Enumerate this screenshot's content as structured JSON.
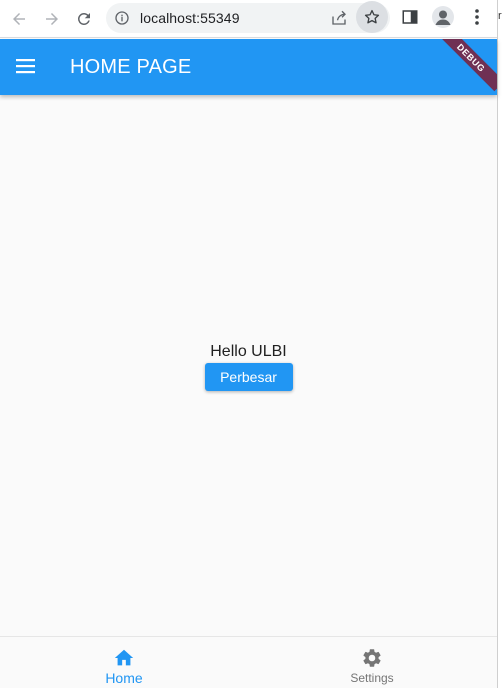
{
  "browser": {
    "url": "localhost:55349",
    "edge_glyph": "r",
    "icons": {
      "back": "arrow-left-icon",
      "forward": "arrow-right-icon",
      "reload": "reload-icon",
      "info": "info-icon",
      "share": "share-icon",
      "bookmark": "star-icon",
      "side_panel": "side-panel-icon",
      "profile": "profile-icon",
      "menu": "kebab-menu-icon"
    }
  },
  "app_bar": {
    "title": "HOME PAGE",
    "debug_label": "DEBUG",
    "background": "#2196f3",
    "menu_icon": "hamburger-icon"
  },
  "content": {
    "greeting": "Hello ULBI",
    "button_label": "Perbesar"
  },
  "bottom_nav": {
    "items": [
      {
        "label": "Home",
        "icon": "home-icon",
        "selected": true,
        "color": "#2196f3"
      },
      {
        "label": "Settings",
        "icon": "gear-icon",
        "selected": false,
        "color": "#757575"
      }
    ]
  }
}
